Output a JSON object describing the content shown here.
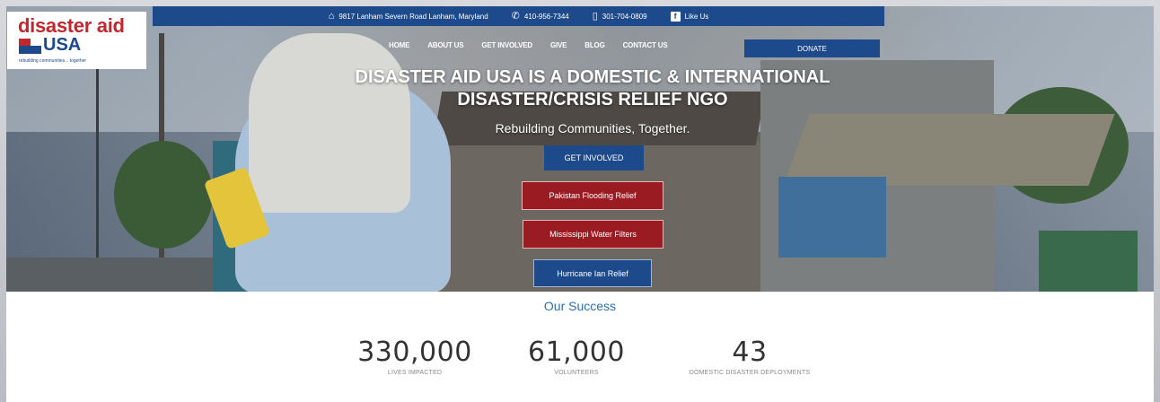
{
  "topbar": {
    "address": "9817 Lanham Severn Road Lanham, Maryland",
    "phone1": "410-956-7344",
    "phone2": "301-704-0809",
    "like": "Like Us",
    "icons": [
      "home-icon",
      "phone-icon",
      "mobile-icon",
      "facebook-icon"
    ]
  },
  "logo": {
    "line1": "disaster aid",
    "line2": "USA",
    "tagline": "rebuilding communities... together"
  },
  "nav": {
    "items": [
      "HOME",
      "ABOUT US",
      "GET INVOLVED",
      "GIVE",
      "BLOG",
      "CONTACT US"
    ],
    "donate": "DONATE"
  },
  "hero": {
    "headline_line1": "DISASTER AID USA IS A DOMESTIC & INTERNATIONAL",
    "headline_line2": "DISASTER/CRISIS RELIEF NGO",
    "subhead": "Rebuilding Communities, Together.",
    "buttons": {
      "get_involved": "GET INVOLVED",
      "pakistan": "Pakistan Flooding Relief",
      "mississippi": "Mississippi Water Filters",
      "hurricane": "Hurricane Ian Relief"
    }
  },
  "success": {
    "title": "Our Success",
    "stats": [
      {
        "value": "330,000",
        "label": "LIVES IMPACTED"
      },
      {
        "value": "61,000",
        "label": "VOLUNTEERS"
      },
      {
        "value": "43",
        "label": "DOMESTIC DISASTER DEPLOYMENTS"
      }
    ]
  },
  "colors": {
    "brand_blue": "#1d4a8a",
    "brand_red": "#c0282e",
    "button_red": "#9b1b22",
    "accent_link": "#2a6fb0"
  }
}
